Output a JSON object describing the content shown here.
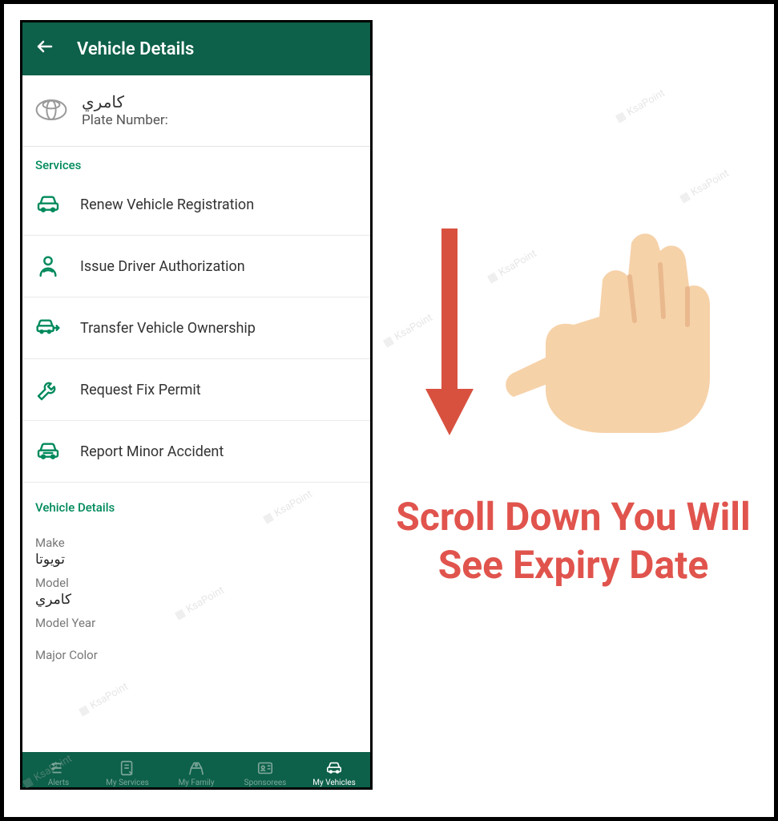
{
  "header": {
    "title": "Vehicle Details"
  },
  "vehicle": {
    "name": "كامري",
    "plate_label": "Plate Number:"
  },
  "services_heading": "Services",
  "services": [
    {
      "label": "Renew Vehicle Registration"
    },
    {
      "label": "Issue Driver Authorization"
    },
    {
      "label": "Transfer Vehicle Ownership"
    },
    {
      "label": "Request Fix Permit"
    },
    {
      "label": "Report Minor Accident"
    }
  ],
  "details_heading": "Vehicle Details",
  "details": {
    "make_label": "Make",
    "make_value": "تويوتا",
    "model_label": "Model",
    "model_value": "كامري",
    "model_year_label": "Model Year",
    "major_color_label": "Major Color"
  },
  "bottom_nav": [
    {
      "label": "Alerts"
    },
    {
      "label": "My Services"
    },
    {
      "label": "My Family"
    },
    {
      "label": "Sponsorees"
    },
    {
      "label": "My Vehicles"
    }
  ],
  "annotation": {
    "text": "Scroll Down You Will See Expiry Date"
  },
  "watermark": "KsaPoint",
  "colors": {
    "primary": "#0d6049",
    "accent": "#008a5c",
    "anno": "#e0544d"
  }
}
